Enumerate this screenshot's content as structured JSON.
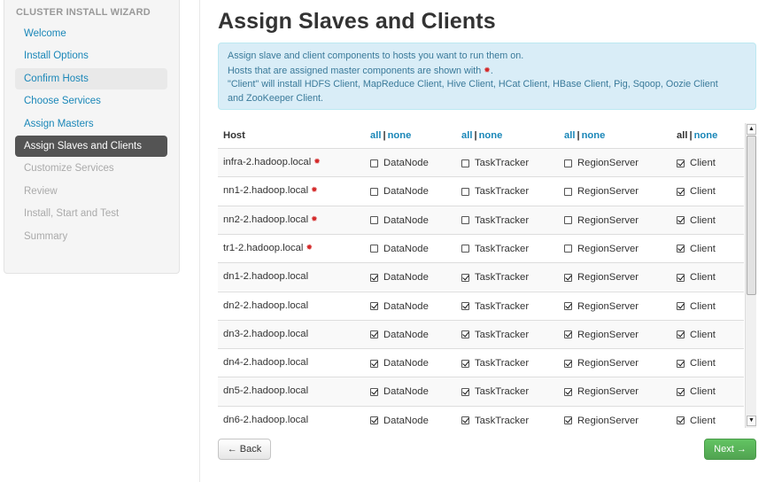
{
  "sidebar": {
    "header": "CLUSTER INSTALL WIZARD",
    "items": [
      {
        "label": "Welcome",
        "state": "link"
      },
      {
        "label": "Install Options",
        "state": "link"
      },
      {
        "label": "Confirm Hosts",
        "state": "hover"
      },
      {
        "label": "Choose Services",
        "state": "link"
      },
      {
        "label": "Assign Masters",
        "state": "link"
      },
      {
        "label": "Assign Slaves and Clients",
        "state": "active"
      },
      {
        "label": "Customize Services",
        "state": "disabled"
      },
      {
        "label": "Review",
        "state": "disabled"
      },
      {
        "label": "Install, Start and Test",
        "state": "disabled"
      },
      {
        "label": "Summary",
        "state": "disabled"
      }
    ]
  },
  "main": {
    "title": "Assign Slaves and Clients",
    "info": {
      "line1": "Assign slave and client components to hosts you want to run them on.",
      "line2": "Hosts that are assigned master components are shown with",
      "line2_end": ".",
      "line3": "\"Client\" will install HDFS Client, MapReduce Client, Hive Client, HCat Client, HBase Client, Pig, Sqoop, Oozie Client",
      "line4": "and ZooKeeper Client."
    },
    "star_glyph": "✹",
    "table": {
      "host_header": "Host",
      "all_label": "all",
      "none_label": "none",
      "separator": "|",
      "columns": [
        "DataNode",
        "TaskTracker",
        "RegionServer",
        "Client"
      ],
      "rows": [
        {
          "host": "infra-2.hadoop.local",
          "master": true,
          "checks": [
            false,
            false,
            false,
            true
          ]
        },
        {
          "host": "nn1-2.hadoop.local",
          "master": true,
          "checks": [
            false,
            false,
            false,
            true
          ]
        },
        {
          "host": "nn2-2.hadoop.local",
          "master": true,
          "checks": [
            false,
            false,
            false,
            true
          ]
        },
        {
          "host": "tr1-2.hadoop.local",
          "master": true,
          "checks": [
            false,
            false,
            false,
            true
          ]
        },
        {
          "host": "dn1-2.hadoop.local",
          "master": false,
          "checks": [
            true,
            true,
            true,
            true
          ]
        },
        {
          "host": "dn2-2.hadoop.local",
          "master": false,
          "checks": [
            true,
            true,
            true,
            true
          ]
        },
        {
          "host": "dn3-2.hadoop.local",
          "master": false,
          "checks": [
            true,
            true,
            true,
            true
          ]
        },
        {
          "host": "dn4-2.hadoop.local",
          "master": false,
          "checks": [
            true,
            true,
            true,
            true
          ]
        },
        {
          "host": "dn5-2.hadoop.local",
          "master": false,
          "checks": [
            true,
            true,
            true,
            true
          ]
        },
        {
          "host": "dn6-2.hadoop.local",
          "master": false,
          "checks": [
            true,
            true,
            true,
            true
          ]
        }
      ]
    },
    "back_label": "← Back",
    "next_label": "Next →"
  },
  "colors": {
    "link": "#1a87b8",
    "active_bg": "#545454",
    "next_bg": "#51a351",
    "info_bg": "#d9edf7",
    "star": "#d42a2a"
  }
}
